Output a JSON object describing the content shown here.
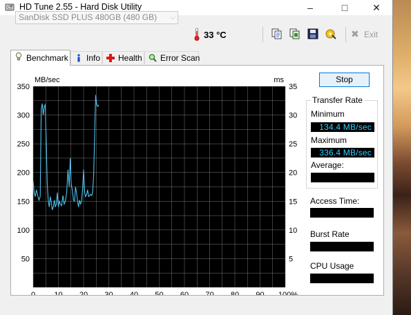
{
  "window": {
    "title": "HD Tune 2.55 - Hard Disk Utility",
    "minimize_glyph": "–",
    "maximize_glyph": "□",
    "close_glyph": "✕"
  },
  "toolbar": {
    "drive": "SanDisk SSD PLUS 480GB (480 GB)",
    "temperature": "33 °C",
    "exit_label": "Exit",
    "icons": [
      "copy-text-icon",
      "copy-screenshot-icon",
      "save-icon",
      "options-icon",
      "exit-icon"
    ]
  },
  "tabs": [
    {
      "label": "Benchmark",
      "icon": "lightbulb-icon",
      "active": true
    },
    {
      "label": "Info",
      "icon": "info-icon",
      "active": false
    },
    {
      "label": "Health",
      "icon": "health-cross-icon",
      "active": false
    },
    {
      "label": "Error Scan",
      "icon": "magnifier-icon",
      "active": false
    }
  ],
  "benchmark": {
    "stop_label": "Stop",
    "transfer_rate_label": "Transfer Rate",
    "minimum_label": "Minimum",
    "minimum_value": "134.4 MB/sec",
    "maximum_label": "Maximum",
    "maximum_value": "336.4 MB/sec",
    "average_label": "Average:",
    "average_value": "",
    "access_time_label": "Access Time:",
    "access_time_value": "",
    "burst_rate_label": "Burst Rate",
    "burst_rate_value": "",
    "cpu_usage_label": "CPU Usage",
    "cpu_usage_value": ""
  },
  "chart_data": {
    "type": "line",
    "ylabel": "MB/sec",
    "y2label": "ms",
    "ylim": [
      0,
      350
    ],
    "y2lim": [
      0,
      35
    ],
    "xlim": [
      0,
      100
    ],
    "yticks": [
      50,
      100,
      150,
      200,
      250,
      300,
      350
    ],
    "y2ticks": [
      5,
      10,
      15,
      20,
      25,
      30,
      35
    ],
    "xticks": [
      "0",
      "10",
      "20",
      "30",
      "40",
      "50",
      "60",
      "70",
      "80",
      "90",
      "100%"
    ],
    "grid": true,
    "background": "#000000",
    "grid_color": "#7a7a7a",
    "series": [
      {
        "color": "#4fc4f0",
        "points": [
          [
            0,
            185
          ],
          [
            0.4,
            165
          ],
          [
            0.8,
            158
          ],
          [
            1.3,
            170
          ],
          [
            1.8,
            160
          ],
          [
            2.3,
            152
          ],
          [
            2.8,
            158
          ],
          [
            3.2,
            310
          ],
          [
            3.6,
            320
          ],
          [
            4,
            300
          ],
          [
            4.4,
            315
          ],
          [
            4.8,
            318
          ],
          [
            5.2,
            250
          ],
          [
            5.6,
            180
          ],
          [
            6,
            150
          ],
          [
            6.4,
            140
          ],
          [
            6.8,
            158
          ],
          [
            7.2,
            148
          ],
          [
            7.6,
            135
          ],
          [
            8,
            140
          ],
          [
            8.4,
            152
          ],
          [
            8.8,
            140
          ],
          [
            9.2,
            145
          ],
          [
            9.6,
            165
          ],
          [
            10,
            140
          ],
          [
            10.4,
            150
          ],
          [
            10.8,
            145
          ],
          [
            11.3,
            142
          ],
          [
            11.8,
            160
          ],
          [
            12.3,
            145
          ],
          [
            12.8,
            150
          ],
          [
            13.3,
            165
          ],
          [
            13.8,
            205
          ],
          [
            14.3,
            175
          ],
          [
            14.7,
            225
          ],
          [
            15.1,
            180
          ],
          [
            15.5,
            170
          ],
          [
            16,
            152
          ],
          [
            16.4,
            150
          ],
          [
            16.8,
            175
          ],
          [
            17.2,
            165
          ],
          [
            17.6,
            150
          ],
          [
            18,
            140
          ],
          [
            18.4,
            152
          ],
          [
            18.8,
            145
          ],
          [
            19.2,
            150
          ],
          [
            19.6,
            170
          ],
          [
            20,
            205
          ],
          [
            20.4,
            165
          ],
          [
            20.8,
            158
          ],
          [
            21.2,
            162
          ],
          [
            21.6,
            170
          ],
          [
            22,
            158
          ],
          [
            22.4,
            160
          ],
          [
            22.8,
            162
          ],
          [
            23.2,
            160
          ],
          [
            23.6,
            165
          ],
          [
            24,
            195
          ],
          [
            24.4,
            270
          ],
          [
            24.8,
            335
          ],
          [
            25.2,
            318
          ],
          [
            25.7,
            315
          ],
          [
            26,
            318
          ]
        ]
      }
    ]
  }
}
